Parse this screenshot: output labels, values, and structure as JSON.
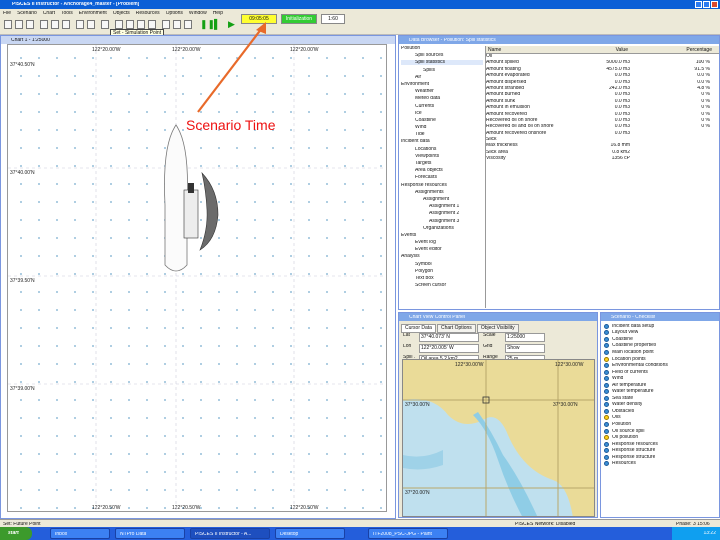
{
  "window": {
    "title": "PISCES II Instructor - Anchorage4_master - [Problem]"
  },
  "menu": [
    "File",
    "Scenario",
    "Chart",
    "Tools",
    "Environment",
    "Objects",
    "Resources",
    "Options",
    "Window",
    "Help"
  ],
  "toolbar": {
    "scenario_time": "09:05:05",
    "status": "Initialization",
    "speed": "1:60",
    "tooltip": "Set - Simulation Point"
  },
  "annotation": {
    "text": "Scenario Time",
    "color": "#e11111"
  },
  "chart": {
    "title": "Chart 1 - 1:25000",
    "lon_labels_top": [
      "122°20.00'W",
      "122°20.00'W",
      "122°20.00'W"
    ],
    "lon_labels_bottom": [
      "122°20.50'W",
      "122°20.50'W",
      "122°20.50'W"
    ],
    "lat_labels": [
      "37°40.50'N",
      "37°40.00'N",
      "37°39.50'N",
      "37°39.00'N"
    ],
    "scale_label": "Set: Future Point"
  },
  "data_browser": {
    "title": "Data Browser - Pollution: Spill statistics",
    "tree": [
      "Pollution",
      "Spill sources",
      "Spill statistics",
      "Spills",
      "Air",
      "Environment",
      "Weather",
      "Meteo data",
      "Currents",
      "Ice",
      "Coastline",
      "Wind",
      "Tide",
      "Incident data",
      "Locations",
      "Viewpoints",
      "Targets",
      "Area objects",
      "Forecasts",
      "Response resources",
      "Assignments",
      "Assignment",
      "Assignment 1",
      "Assignment 2",
      "Assignment 3",
      "Organizations",
      "Events",
      "Event log",
      "Event editor",
      "Analysis",
      "Symbol",
      "Polygon",
      "Text box",
      "Screen cursor"
    ],
    "columns": [
      "Name",
      "Value",
      "Percentage"
    ],
    "rows": [
      [
        "Oil",
        "",
        ""
      ],
      [
        "Amount spilled",
        "5000.0 m3",
        "100 %"
      ],
      [
        "Amount floating",
        "4575.0 m3",
        "91.5 %"
      ],
      [
        "Amount evaporated",
        "0.0 m3",
        "0.0 %"
      ],
      [
        "Amount dispersed",
        "0.0 m3",
        "0.0 %"
      ],
      [
        "Amount stranded",
        "242.0 m3",
        "4.8 %"
      ],
      [
        "Amount burned",
        "0.0 m3",
        "0 %"
      ],
      [
        "Amount sunk",
        "0.0 m3",
        "0 %"
      ],
      [
        "Amount in emulsion",
        "0.0 m3",
        "0 %"
      ],
      [
        "Amount recovered",
        "0.0 m3",
        "0 %"
      ],
      [
        "Recovered oil on shore",
        "0.0 m3",
        "0 %"
      ],
      [
        "Recovered oil and oil on shore",
        "0.0 m3",
        "0 %"
      ],
      [
        "Amount recovered onshore",
        "0.0 m3",
        ""
      ],
      [
        "Slick",
        "",
        ""
      ],
      [
        "Max thickness",
        "16.8 mm",
        ""
      ],
      [
        "Slick area",
        "0.8 km2",
        ""
      ],
      [
        "Viscosity",
        "1356 cP",
        ""
      ]
    ]
  },
  "control_panel": {
    "title": "Chart View Control Panel",
    "tabs": [
      "Cursor Data",
      "Chart Options",
      "Object Visibility"
    ],
    "fields": [
      [
        "Lat",
        "37°40.073' N",
        "Scale",
        "1:25000"
      ],
      [
        "Lon",
        "122°20.005' W",
        "Grid",
        "Show"
      ],
      [
        "Spill 1",
        "Oil area 5.2 km2",
        "Range",
        "25 m"
      ]
    ],
    "map_labels": [
      "122°30.00'W",
      "122°30.00'W",
      "37°30.00'N",
      "37°30.00'N",
      "37°20.00'N"
    ]
  },
  "checklist": {
    "title": "Scenario - Checklist",
    "items": [
      {
        "label": "Incident data setup",
        "status": "ok"
      },
      {
        "label": "Layout view",
        "status": "ok"
      },
      {
        "label": "Coastline",
        "status": "ok"
      },
      {
        "label": "Coastline properties",
        "status": "ok"
      },
      {
        "label": "Main location point",
        "status": "ok"
      },
      {
        "label": "Location points",
        "status": "warn"
      },
      {
        "label": "Environmental conditions",
        "status": "ok"
      },
      {
        "label": "Field of currents",
        "status": "ok"
      },
      {
        "label": "Wind",
        "status": "ok"
      },
      {
        "label": "Air temperature",
        "status": "ok"
      },
      {
        "label": "Water temperature",
        "status": "ok"
      },
      {
        "label": "Sea state",
        "status": "ok"
      },
      {
        "label": "Water density",
        "status": "ok"
      },
      {
        "label": "Obstacles",
        "status": "ok"
      },
      {
        "label": "Oils",
        "status": "warn"
      },
      {
        "label": "Pollution",
        "status": "ok"
      },
      {
        "label": "Oil source spill",
        "status": "ok"
      },
      {
        "label": "Oil pollution",
        "status": "warn"
      },
      {
        "label": "Response resources",
        "status": "ok"
      },
      {
        "label": "Response structure",
        "status": "ok"
      },
      {
        "label": "Response structure",
        "status": "ok"
      },
      {
        "label": "Resources",
        "status": "ok"
      }
    ]
  },
  "statusbar": {
    "left": "Set: Future Point",
    "center": "PISCES Network: Disabled",
    "right": "Phase: 3 15:06"
  },
  "taskbar": {
    "start": "start",
    "tasks": [
      "Inbox",
      "NTPro Data",
      "PISCES II Instructor - A...",
      "Desktop",
      "ITF2008_PSC-JPG - Paint"
    ],
    "clock": "13:22"
  }
}
